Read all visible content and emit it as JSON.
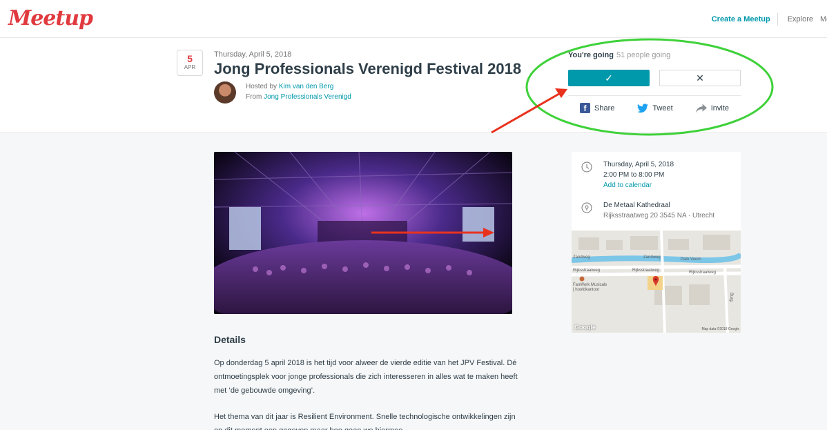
{
  "nav": {
    "logo": "Meetup",
    "create": "Create a Meetup",
    "explore": "Explore",
    "messages": "Messages"
  },
  "event": {
    "badge_day": "5",
    "badge_month": "APR",
    "date": "Thursday, April 5, 2018",
    "title": "Jong Professionals Verenigd Festival 2018",
    "hosted_prefix": "Hosted by ",
    "host_name": "Kim van den Berg",
    "from_prefix": "From ",
    "group_name": "Jong Professionals Verenigd"
  },
  "rsvp": {
    "status": "You're going",
    "count": "51 people going",
    "yes_symbol": "✓",
    "no_symbol": "✕",
    "share": "Share",
    "tweet": "Tweet",
    "invite": "Invite"
  },
  "details": {
    "heading": "Details",
    "paragraph1": "Op donderdag 5 april 2018 is het tijd voor alweer de vierde editie van het JPV Festival. Dé ontmoetingsplek voor jonge professionals die zich interesseren in alles wat te maken heeft met ‘de gebouwde omgeving’.",
    "paragraph2": "Het thema van dit jaar is Resilient Environment. Snelle technologische ontwikkelingen zijn op dit moment een gegeven maar hoe gaan we hiermee"
  },
  "card": {
    "date_line": "Thursday, April 5, 2018",
    "time_line": "2:00 PM to 8:00 PM",
    "add_calendar": "Add to calendar",
    "venue": "De Metaal Kathedraal",
    "address": "Rijksstraatweg 20 3545 NA · Utrecht"
  },
  "map": {
    "label_zandweg1": "Zandweg",
    "label_zandweg2": "Zandweg",
    "label_parkvoorn": "Park Voorn",
    "label_rijks1": "Rijksstraatweg",
    "label_rijks2": "Rijksstraatweg",
    "label_rijks3": "Rijksstraatweg",
    "label_fanwork": "FanWork Musicals",
    "label_fanwork2": "| hoofdkantoor",
    "label_vertical": "Burg.",
    "google": "Google",
    "attribution": "Map data ©2018 Google"
  },
  "colors": {
    "brand": "#e0393e",
    "accent": "#0098ab",
    "annotation_green": "#3fd13a",
    "annotation_red": "#e8321e"
  },
  "icons": {
    "facebook": "facebook-icon",
    "twitter": "twitter-icon",
    "invite": "share-arrow-icon",
    "clock": "clock-icon",
    "location": "location-pin-icon"
  }
}
